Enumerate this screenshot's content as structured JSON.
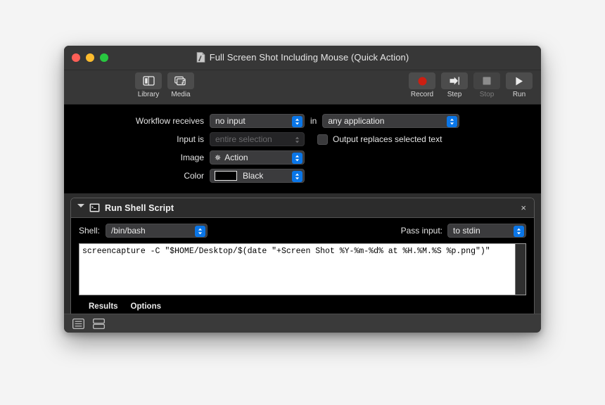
{
  "window": {
    "title": "Full Screen Shot Including Mouse (Quick Action)",
    "title_icon": "workflow-document-icon",
    "traffic_lights": [
      {
        "name": "close",
        "color": "#ff5f57"
      },
      {
        "name": "minimize",
        "color": "#febc2e"
      },
      {
        "name": "zoom",
        "color": "#28c840"
      }
    ]
  },
  "toolbar": {
    "left_items": [
      {
        "label": "Library",
        "icon": "library-panel-icon",
        "enabled": true
      },
      {
        "label": "Media",
        "icon": "media-browser-icon",
        "enabled": true
      }
    ],
    "right_items": [
      {
        "label": "Record",
        "icon": "record-circle-icon",
        "enabled": true
      },
      {
        "label": "Step",
        "icon": "step-arrow-icon",
        "enabled": true
      },
      {
        "label": "Stop",
        "icon": "stop-square-icon",
        "enabled": false
      },
      {
        "label": "Run",
        "icon": "play-triangle-icon",
        "enabled": true
      }
    ]
  },
  "settings": {
    "receives_label": "Workflow receives",
    "receives_value": "no input",
    "in_word": "in",
    "in_app_value": "any application",
    "input_is_label": "Input is",
    "input_is_value": "entire selection",
    "checkbox_label": "Output replaces selected text",
    "checkbox_checked": false,
    "image_label": "Image",
    "image_value": "Action",
    "image_glyph": "gear-icon",
    "color_label": "Color",
    "color_value": "Black",
    "color_swatch_hex": "#000000"
  },
  "action": {
    "title": "Run Shell Script",
    "icon": "terminal-icon",
    "disclosure": "disclosure-triangle-expanded",
    "close_glyph": "×",
    "shell_label": "Shell:",
    "shell_value": "/bin/bash",
    "pass_input_label": "Pass input:",
    "pass_input_value": "to stdin",
    "script": "screencapture -C \"$HOME/Desktop/$(date \"+Screen Shot %Y-%m-%d% at %H.%M.%S %p.png\")\"",
    "tabs": [
      "Results",
      "Options"
    ]
  },
  "footer": {
    "view_buttons": [
      {
        "name": "list-view-icon",
        "selected": true
      },
      {
        "name": "split-view-icon",
        "selected": false
      }
    ]
  },
  "colors": {
    "accent_blue": "#0a76e8",
    "window_chrome": "#373737",
    "pane_black": "#000000",
    "canvas_gray": "#2d2d2d",
    "desktop": "#f4f4f4"
  }
}
